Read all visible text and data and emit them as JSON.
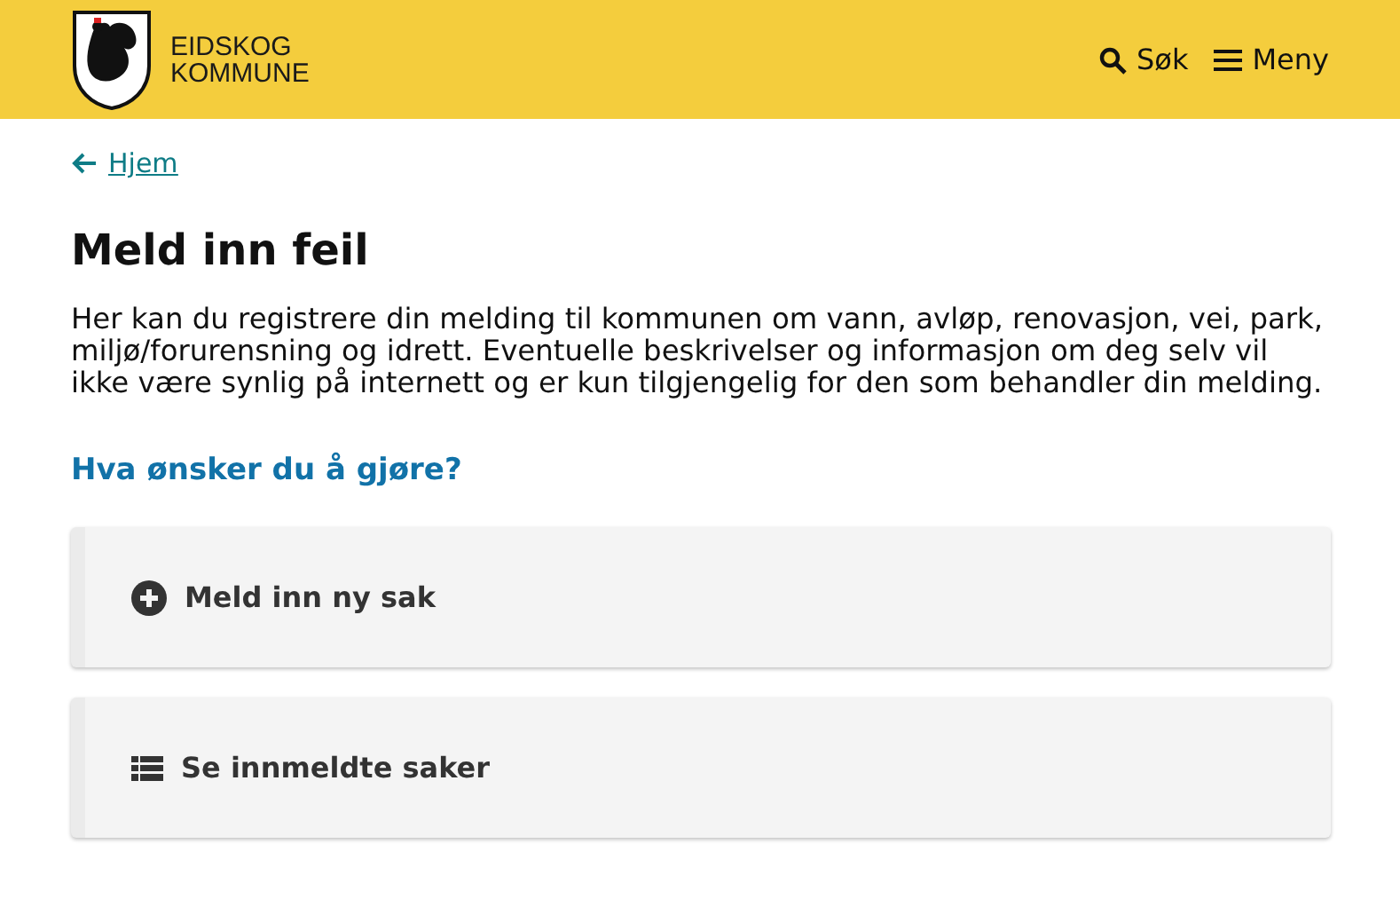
{
  "header": {
    "logo_lines": [
      "EIDSKOG",
      "KOMMUNE"
    ],
    "search": "Søk",
    "menu": "Meny"
  },
  "back_link": "Hjem",
  "title": "Meld inn feil",
  "intro": "Her kan du registrere din melding til kommunen om vann, avløp, renovasjon, vei, park, miljø/forurensning og idrett. Eventuelle beskrivelser og informasjon om deg selv vil ikke være synlig på internett og er kun tilgjengelig for den som behandler din melding.",
  "question": "Hva ønsker du å gjøre?",
  "actions": [
    {
      "kind": "add",
      "label": "Meld inn ny sak"
    },
    {
      "kind": "list",
      "label": "Se innmeldte saker"
    }
  ]
}
